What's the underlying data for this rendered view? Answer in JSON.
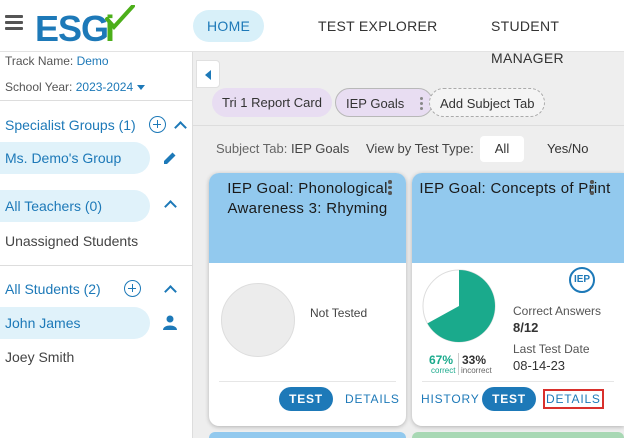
{
  "header": {
    "logo_text": "ESGi",
    "nav": {
      "home": "HOME",
      "test_explorer": "TEST EXPLORER",
      "student_manager": "STUDENT MANAGER"
    }
  },
  "sidebar": {
    "track_label": "Track Name:",
    "track_value": "Demo",
    "year_label": "School Year:",
    "year_value": "2023-2024",
    "specialist_groups": "Specialist Groups (1)",
    "group_name": "Ms. Demo's Group",
    "all_teachers": "All Teachers (0)",
    "unassigned": "Unassigned Students",
    "all_students": "All Students (2)",
    "students": [
      "John James",
      "Joey Smith"
    ]
  },
  "subtabs": {
    "tab1": "Tri 1 Report Card",
    "tab2": "IEP Goals",
    "add": "Add Subject Tab"
  },
  "filter": {
    "subject_label": "Subject Tab:",
    "subject_value": "IEP Goals",
    "view_label": "View by Test Type:",
    "all": "All",
    "yes_no": "Yes/No"
  },
  "cards": [
    {
      "title": "IEP Goal: Phonological Awareness 3: Rhyming",
      "status": "Not Tested",
      "test": "TEST",
      "details": "DETAILS"
    },
    {
      "title": "IEP Goal: Concepts of Print",
      "badge": "IEP",
      "correct_pct": "67%",
      "correct_lbl": "correct",
      "incorrect_pct": "33%",
      "incorrect_lbl": "incorrect",
      "correct_answers_label": "Correct Answers",
      "correct_answers_value": "8/12",
      "last_test_label": "Last Test Date",
      "last_test_value": "08-14-23",
      "history": "HISTORY",
      "test": "TEST",
      "details": "DETAILS",
      "correct_fraction": 0.67
    }
  ],
  "colors": {
    "accent": "#1d79b8",
    "logo_green": "#4caf1a",
    "card_header": "#92c9ee",
    "correct": "#1aaa8c",
    "highlight": "#d9302c"
  }
}
